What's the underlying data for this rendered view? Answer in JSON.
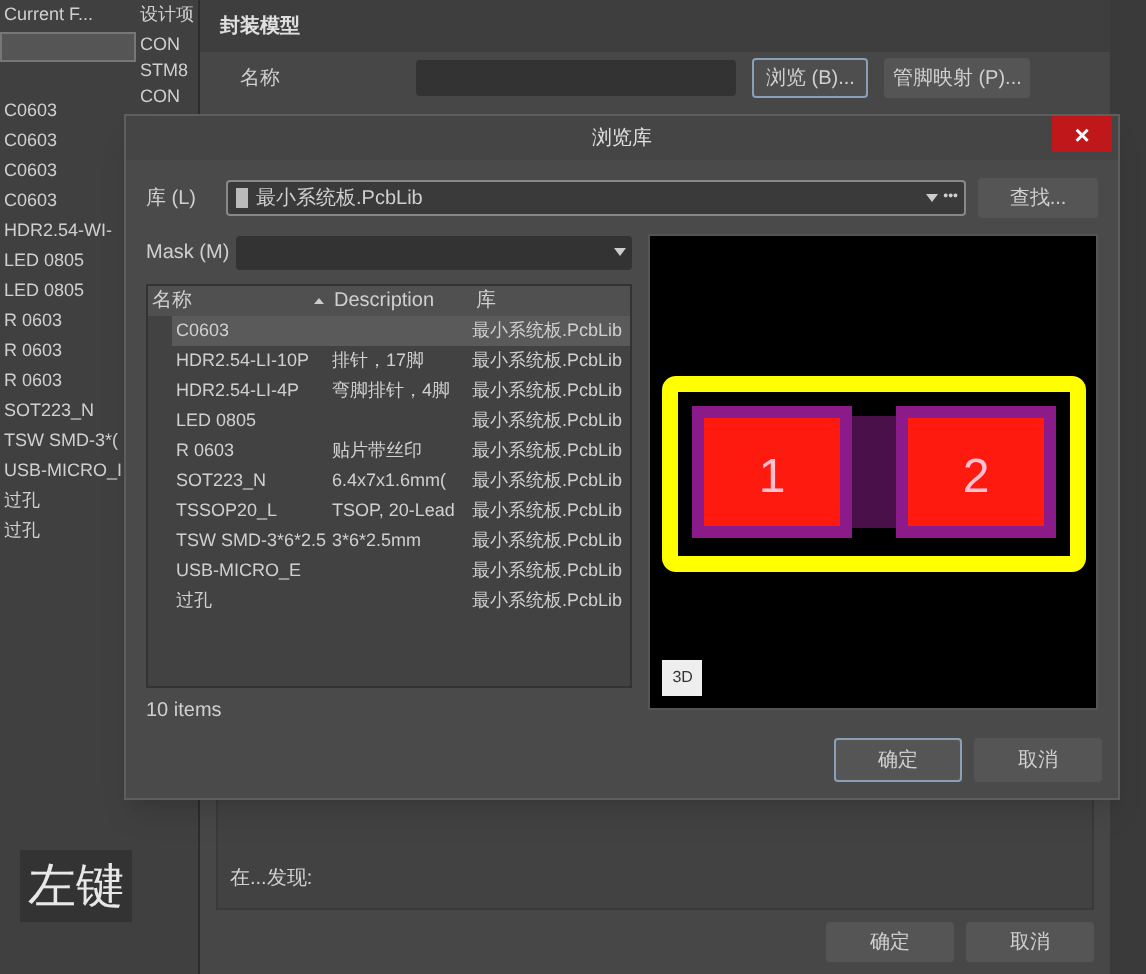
{
  "left_panel": {
    "header": "Current F...",
    "header_2": "设计项",
    "column_2": [
      "CON",
      "STM8",
      "CON"
    ],
    "items": [
      "C0603",
      "C0603",
      "C0603",
      "C0603",
      "HDR2.54-WI-",
      "LED 0805",
      "LED 0805",
      "R 0603",
      "R 0603",
      "R 0603",
      "SOT223_N",
      "TSW SMD-3*(",
      "USB-MICRO_I",
      "过孔",
      "过孔"
    ]
  },
  "caption": "左键",
  "back_dialog": {
    "section": "封装模型",
    "name_label": "名称",
    "browse_button": "浏览 (B)...",
    "pin_map_button": "管脚映射 (P)...",
    "found_label": "在...发现:",
    "ok": "确定",
    "cancel": "取消"
  },
  "dialog": {
    "title": "浏览库",
    "close": "×",
    "library_label": "库 (L)",
    "library_value": "最小系统板.PcbLib",
    "more": "•••",
    "find_button": "查找...",
    "mask_label": "Mask (M)",
    "columns": [
      "名称",
      "Description",
      "库"
    ],
    "rows": [
      {
        "name": "C0603",
        "description": "",
        "library": "最小系统板.PcbLib",
        "selected": true
      },
      {
        "name": "HDR2.54-LI-10P",
        "description": "排针，17脚",
        "library": "最小系统板.PcbLib",
        "selected": false
      },
      {
        "name": "HDR2.54-LI-4P",
        "description": "弯脚排针，4脚",
        "library": "最小系统板.PcbLib",
        "selected": false
      },
      {
        "name": "LED 0805",
        "description": "",
        "library": "最小系统板.PcbLib",
        "selected": false
      },
      {
        "name": "R 0603",
        "description": "贴片带丝印",
        "library": "最小系统板.PcbLib",
        "selected": false
      },
      {
        "name": "SOT223_N",
        "description": "6.4x7x1.6mm(",
        "library": "最小系统板.PcbLib",
        "selected": false
      },
      {
        "name": "TSSOP20_L",
        "description": "TSOP, 20-Lead",
        "library": "最小系统板.PcbLib",
        "selected": false
      },
      {
        "name": "TSW SMD-3*6*2.5",
        "description": "3*6*2.5mm",
        "library": "最小系统板.PcbLib",
        "selected": false
      },
      {
        "name": "USB-MICRO_E",
        "description": "",
        "library": "最小系统板.PcbLib",
        "selected": false
      },
      {
        "name": "过孔",
        "description": "",
        "library": "最小系统板.PcbLib",
        "selected": false
      }
    ],
    "count": "10 items",
    "preview": {
      "pads": [
        "1",
        "2"
      ],
      "view_3d": "3D"
    },
    "ok": "确定",
    "cancel": "取消"
  }
}
